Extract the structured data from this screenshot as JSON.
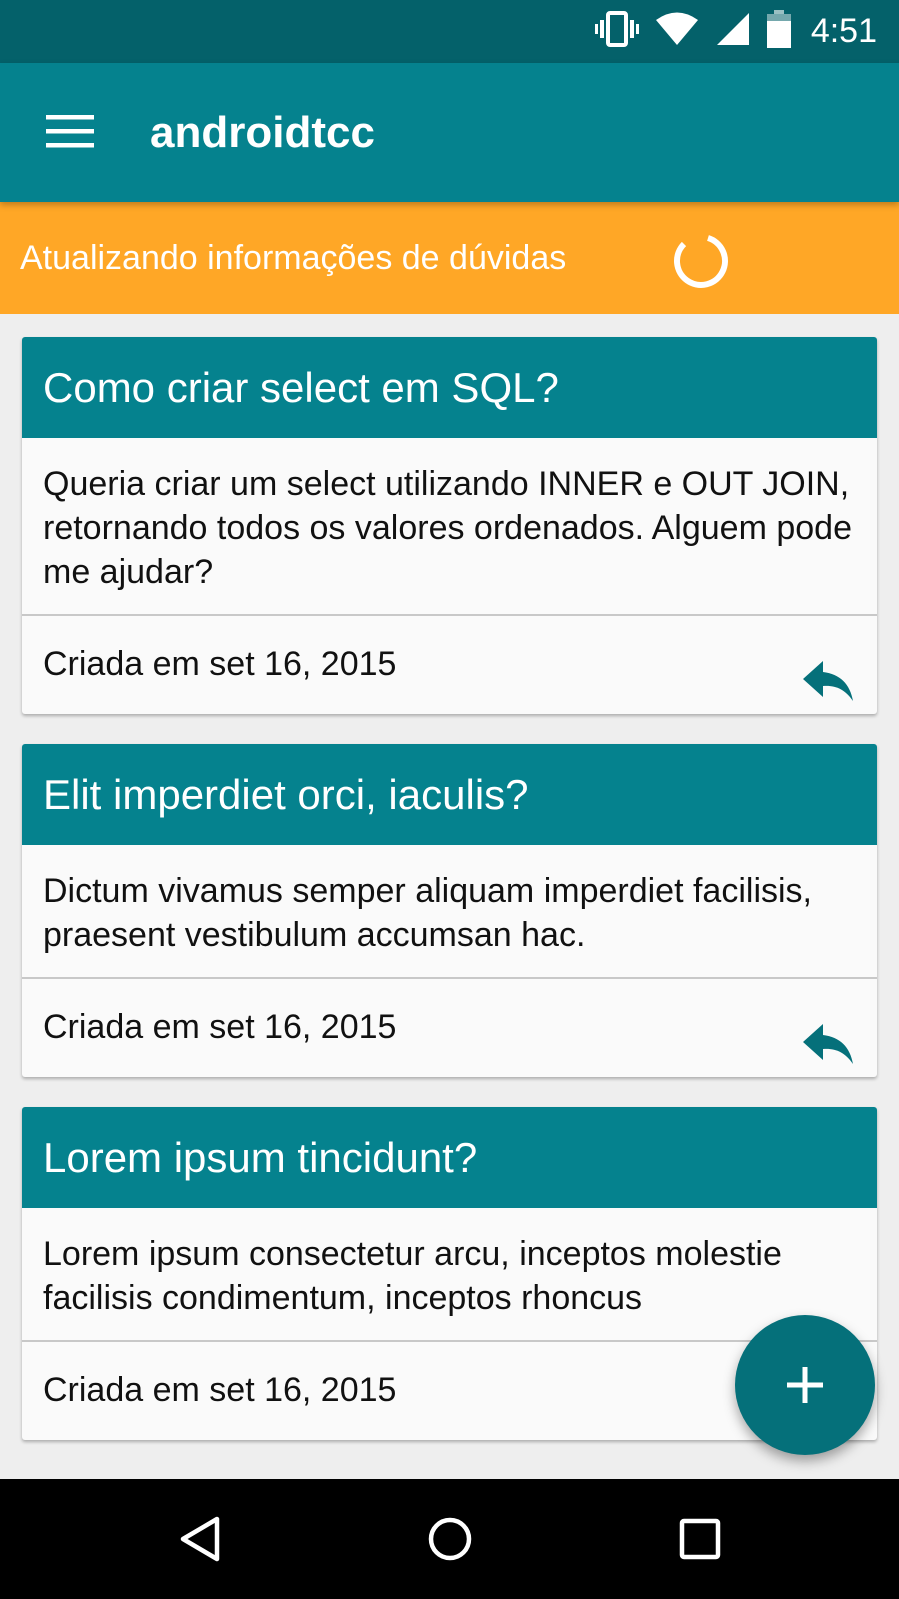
{
  "status_bar": {
    "time": "4:51",
    "icons": [
      "vibrate-icon",
      "wifi-icon",
      "cell-signal-icon",
      "battery-icon"
    ]
  },
  "app_bar": {
    "title": "androidtcc",
    "menu_icon": "hamburger-menu-icon"
  },
  "sync_banner": {
    "text": "Atualizando informações de dúvidas",
    "indicator": "spinner-icon"
  },
  "questions": [
    {
      "title": "Como criar select em SQL?",
      "body": "Queria criar um select utilizando INNER e OUT JOIN, retornando todos os valores ordenados. Alguem pode me ajudar?",
      "created": "Criada em set 16, 2015",
      "action_icon": "reply-icon"
    },
    {
      "title": "Elit imperdiet orci, iaculis?",
      "body": "Dictum vivamus semper aliquam imperdiet facilisis, praesent vestibulum accumsan hac.",
      "created": "Criada em set 16, 2015",
      "action_icon": "reply-icon"
    },
    {
      "title": "Lorem ipsum tincidunt?",
      "body": "Lorem ipsum consectetur arcu, inceptos molestie facilisis condimentum, inceptos rhoncus",
      "created": "Criada em set 16, 2015",
      "action_icon": "reply-icon"
    }
  ],
  "fab": {
    "icon": "plus-icon"
  },
  "nav_bar": {
    "icons": [
      "back-icon",
      "home-icon",
      "recents-icon"
    ]
  },
  "colors": {
    "primary": "#05828e",
    "primary_dark": "#04616a",
    "accent": "#ffa726",
    "fab": "#05707a",
    "reply_icon": "#05707a"
  }
}
